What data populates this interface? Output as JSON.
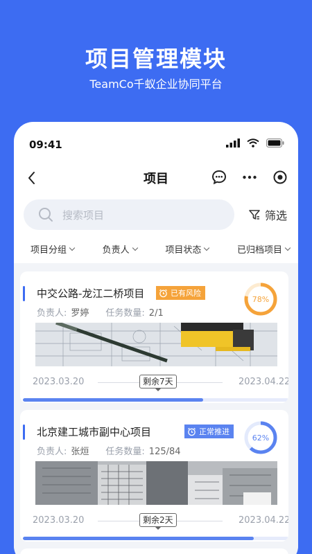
{
  "promo": {
    "title": "项目管理模块",
    "subtitle": "TeamCo千蚁企业协同平台"
  },
  "status_bar": {
    "time": "09:41"
  },
  "navbar": {
    "title": "项目"
  },
  "search": {
    "placeholder": "搜索项目",
    "filter_label": "筛选"
  },
  "filters": [
    {
      "label": "项目分组"
    },
    {
      "label": "负责人"
    },
    {
      "label": "项目状态"
    },
    {
      "label": "已归档项目"
    }
  ],
  "projects": [
    {
      "name": "中交公路-龙江二桥项目",
      "badge": "已有风险",
      "badge_color": "#f5a33a",
      "owner_label": "负责人:",
      "owner": "罗婷",
      "tasks_label": "任务数量:",
      "tasks": "2/1",
      "percent_label": "78%",
      "percent": 0.78,
      "ring_color": "#f5a33a",
      "start_date": "2023.03.20",
      "end_date": "2023.04.22",
      "remaining": "剩余7天",
      "progress": 0.68
    },
    {
      "name": "北京建工城市副中心项目",
      "badge": "正常推进",
      "badge_color": "#5a83f0",
      "owner_label": "负责人:",
      "owner": "张烜",
      "tasks_label": "任务数量:",
      "tasks": "125/84",
      "percent_label": "62%",
      "percent": 0.62,
      "ring_color": "#5a83f0",
      "start_date": "2023.03.20",
      "end_date": "2023.04.22",
      "remaining": "剩余2天",
      "progress": 0.87
    }
  ],
  "colors": {
    "accent": "#3d6cf2",
    "warning": "#f5a33a",
    "normal": "#5a83f0"
  }
}
